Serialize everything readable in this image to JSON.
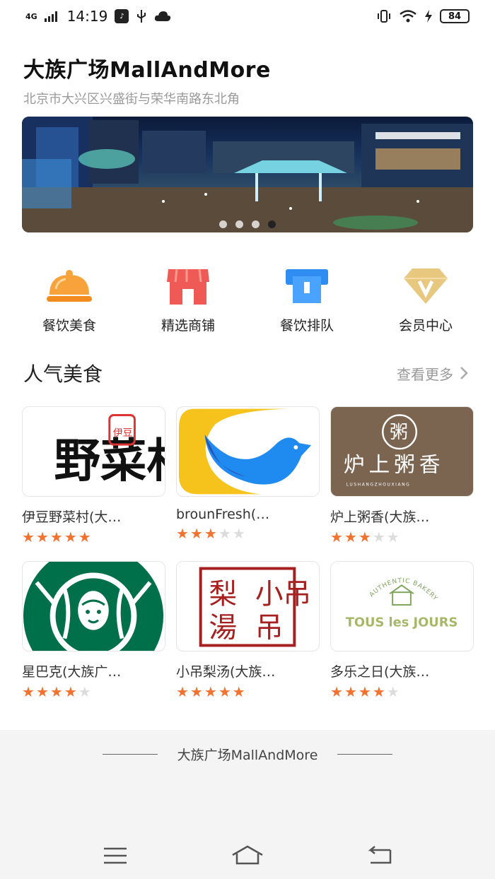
{
  "status_bar": {
    "network": "4G",
    "time": "14:19",
    "battery": "84"
  },
  "mall": {
    "name": "大族广场MallAndMore",
    "address": "北京市大兴区兴盛街与荣华南路东北角"
  },
  "banner": {
    "page_count": 4,
    "active_index": 3
  },
  "quick_nav": [
    {
      "label": "餐饮美食",
      "icon": "food-cloche-icon"
    },
    {
      "label": "精选商铺",
      "icon": "storefront-icon"
    },
    {
      "label": "餐饮排队",
      "icon": "queue-ticket-icon"
    },
    {
      "label": "会员中心",
      "icon": "member-diamond-icon"
    }
  ],
  "section": {
    "title": "人气美食",
    "more_label": "查看更多"
  },
  "shops": [
    {
      "name": "伊豆野菜村(大…",
      "rating": 5,
      "logo_text": "野菜村",
      "seal_text": "伊豆"
    },
    {
      "name": "brounFresh(…",
      "rating": 3
    },
    {
      "name": "炉上粥香(大族…",
      "rating": 3,
      "logo_text": "炉上粥香",
      "seal_text": "粥",
      "logo_subtext": "LUSHANGZHOUXIANG"
    },
    {
      "name": "星巴克(大族广…",
      "rating": 4
    },
    {
      "name": "小吊梨汤(大族…",
      "rating": 5,
      "logo_text": "小吊梨湯"
    },
    {
      "name": "多乐之日(大族…",
      "rating": 4,
      "logo_text": "TOUS les JOURS",
      "logo_subtext": "AUTHENTIC BAKERY"
    }
  ],
  "footer": {
    "brand": "大族广场MallAndMore"
  },
  "colors": {
    "star_active": "#f2732f",
    "star_inactive": "#dcdcdc",
    "accent_orange": "#f7a23a",
    "accent_red": "#f05a56",
    "accent_blue": "#2f8cf0",
    "accent_gold": "#e8c77f"
  }
}
